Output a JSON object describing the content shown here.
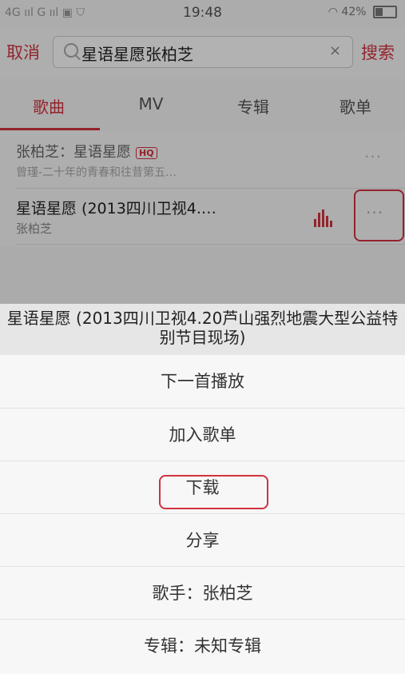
{
  "status_bar": {
    "network": "4G ııl  G ııl  ▣ ⛉",
    "time": "19:48",
    "battery": "42%"
  },
  "search": {
    "cancel_label": "取消",
    "query": "星语星愿张柏芝",
    "clear_icon": "×",
    "search_label": "搜索"
  },
  "tabs": [
    "歌曲",
    "MV",
    "专辑",
    "歌单"
  ],
  "songs": [
    {
      "title": "张柏芝：星语星愿",
      "badge": "HQ",
      "subtitle": "曾瑾-二十年的青春和往昔第五…",
      "more": "···"
    },
    {
      "title": "星语星愿 (2013四川卫视4.…",
      "subtitle": "张柏芝",
      "more": "···"
    }
  ],
  "sheet": {
    "title": "星语星愿 (2013四川卫视4.20芦山强烈地震大型公益特别节目现场)",
    "items": [
      "下一首播放",
      "加入歌单",
      "下载",
      "分享",
      "歌手：张柏芝",
      "专辑：未知专辑"
    ]
  },
  "colors": {
    "accent": "#d5333f"
  }
}
